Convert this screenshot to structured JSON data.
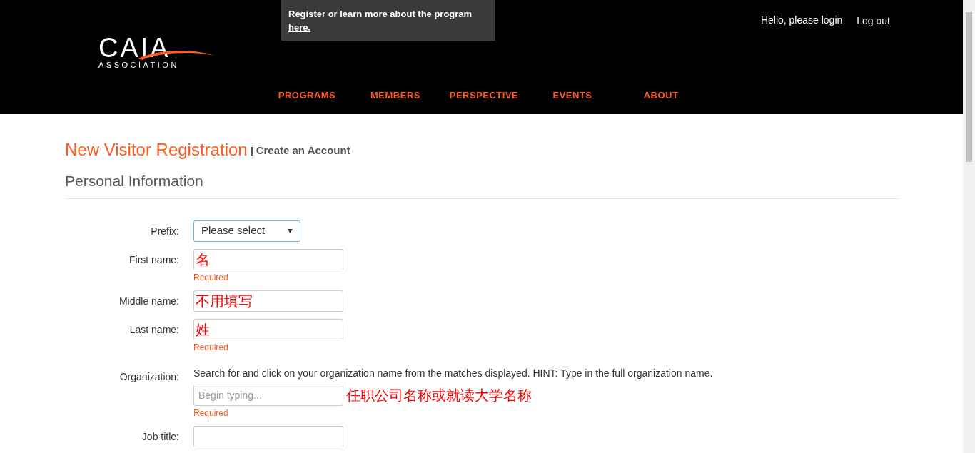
{
  "header": {
    "logo": {
      "wordmark": "CAIA",
      "subtitle": "ASSOCIATION"
    },
    "promo": {
      "text": "Register or learn more about the program ",
      "link": "here."
    },
    "greeting": "Hello, please login",
    "logout": "Log out",
    "nav": [
      {
        "label": "PROGRAMS"
      },
      {
        "label": "MEMBERS"
      },
      {
        "label": "PERSPECTIVE"
      },
      {
        "label": "EVENTS"
      },
      {
        "label": "ABOUT"
      }
    ]
  },
  "page": {
    "title": "New Visitor Registration",
    "subtitle": "Create an Account",
    "section": "Personal Information"
  },
  "fields": [
    {
      "label": "Prefix:",
      "kind": "select",
      "value": "Please select",
      "focused": true
    },
    {
      "label": "First name:",
      "kind": "text",
      "annotation": "名",
      "required": "Required",
      "focused": false
    },
    {
      "label": "Middle name:",
      "kind": "text",
      "annotation": "不用填写",
      "focused": false
    },
    {
      "label": "Last name:",
      "kind": "text",
      "annotation": "姓",
      "required": "Required",
      "focused": false
    },
    {
      "label": "Organization:",
      "kind": "search",
      "hint": "Search for and click on your organization name from the matches displayed. HINT: Type in the full organization name.",
      "placeholder": "Begin typing...",
      "annotation": "任职公司名称或就读大学名称",
      "required": "Required",
      "focused": false
    },
    {
      "label": "Job title:",
      "kind": "text",
      "focused": false
    }
  ]
}
